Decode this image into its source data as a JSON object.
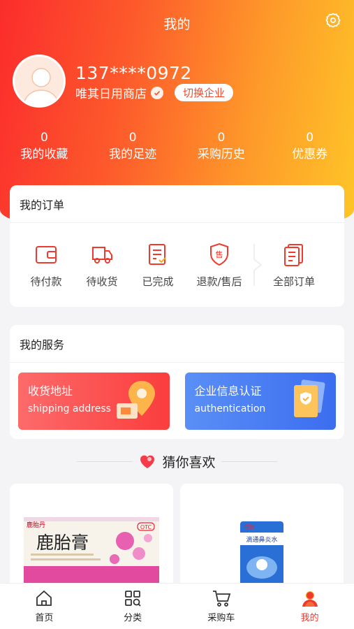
{
  "header": {
    "title": "我的"
  },
  "profile": {
    "phone": "137****0972",
    "shop_name": "唯其日用商店",
    "switch_label": "切换企业"
  },
  "stats": [
    {
      "count": "0",
      "label": "我的收藏"
    },
    {
      "count": "0",
      "label": "我的足迹"
    },
    {
      "count": "0",
      "label": "采购历史"
    },
    {
      "count": "0",
      "label": "优惠券"
    }
  ],
  "orders": {
    "title": "我的订单",
    "items": [
      {
        "label": "待付款",
        "icon": "wallet-icon"
      },
      {
        "label": "待收货",
        "icon": "truck-icon"
      },
      {
        "label": "已完成",
        "icon": "checklist-icon"
      },
      {
        "label": "退款/售后",
        "icon": "shield-sale-icon"
      },
      {
        "label": "全部订单",
        "icon": "orders-icon"
      }
    ],
    "sale_glyph": "售"
  },
  "services": {
    "title": "我的服务",
    "items": [
      {
        "title": "收货地址",
        "subtitle": "shipping address",
        "icon": "location-pin-icon"
      },
      {
        "title": "企业信息认证",
        "subtitle": "authentication",
        "icon": "certificate-icon"
      }
    ]
  },
  "recommend": {
    "title": "猜你喜欢"
  },
  "products": [
    {
      "name": "鹿胎膏",
      "brand": "鹿胎丹",
      "badge": "OTC"
    },
    {
      "name": "滴通鼻炎水",
      "brand": "恒信"
    }
  ],
  "tabbar": [
    {
      "label": "首页",
      "icon": "home-icon"
    },
    {
      "label": "分类",
      "icon": "category-icon"
    },
    {
      "label": "采购车",
      "icon": "cart-icon"
    },
    {
      "label": "我的",
      "icon": "profile-icon",
      "active": true
    }
  ],
  "colors": {
    "accent": "#ef3a2d",
    "gradient_start": "#fb2c2c",
    "gradient_end": "#fec527",
    "auth_blue": "#3b6df0"
  }
}
